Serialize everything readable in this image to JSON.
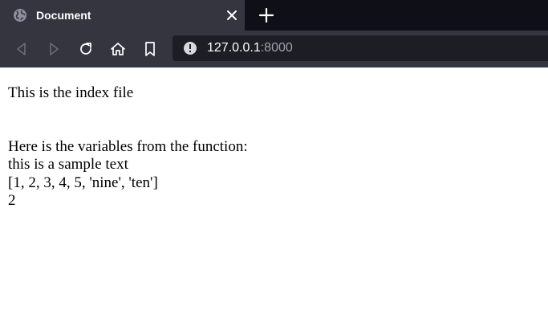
{
  "tab": {
    "title": "Document",
    "favicon": "globe-icon"
  },
  "toolbar": {
    "back": "back-icon",
    "forward": "forward-icon",
    "reload": "reload-icon",
    "home": "home-icon",
    "bookmark": "bookmark-icon"
  },
  "url": {
    "host": "127.0.0.1",
    "port": ":8000"
  },
  "page": {
    "heading": "This is the index file",
    "intro": "Here is the variables from the function:",
    "text_var": "this is a sample text",
    "list_var": "[1, 2, 3, 4, 5, 'nine', 'ten']",
    "number_var": "2"
  },
  "colors": {
    "tabbar_bg": "#0f0f17",
    "toolbar_bg": "#34353f",
    "urlbar_bg": "#1d1d25"
  }
}
